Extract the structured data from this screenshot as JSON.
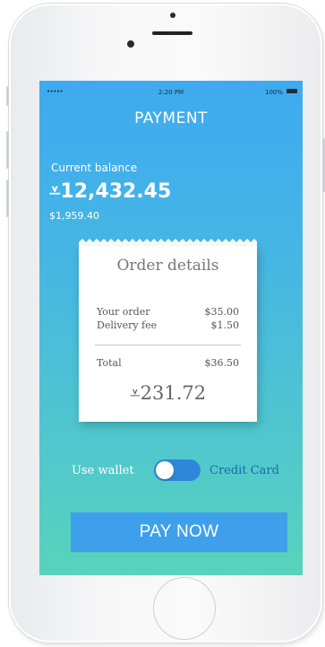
{
  "status_bar": {
    "signal": "•••••",
    "time": "2:20 PM",
    "battery": "100%"
  },
  "header": {
    "title": "PAYMENT"
  },
  "balance": {
    "label": "Current balance",
    "value": "⩡12,432.45",
    "fiat": "$1,959.40"
  },
  "order": {
    "title": "Order details",
    "items": [
      {
        "label": "Your order",
        "value": "$35.00"
      },
      {
        "label": "Delivery fee",
        "value": "$1.50"
      }
    ],
    "total_label": "Total",
    "total_value": "$36.50",
    "total_crypto": "⩡231.72"
  },
  "payment_method": {
    "left_label": "Use wallet",
    "right_label": "Credit Card",
    "selected": "Use wallet"
  },
  "actions": {
    "pay_label": "PAY NOW"
  },
  "colors": {
    "gradient_top": "#3eaaf0",
    "gradient_bottom": "#58d3bd",
    "button": "#3ea0ea",
    "toggle": "#2f86d8",
    "credit_card_text": "#1f67a8"
  }
}
